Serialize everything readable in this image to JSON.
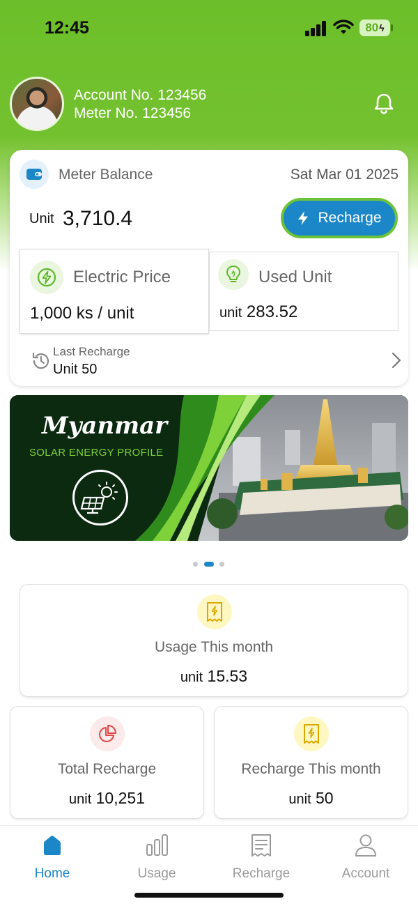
{
  "status_bar": {
    "time": "12:45",
    "battery": "80"
  },
  "header": {
    "account_label": "Account No. 123456",
    "meter_label": "Meter No. 123456"
  },
  "balance_card": {
    "title": "Meter Balance",
    "date": "Sat Mar 01 2025",
    "unit_prefix": "Unit",
    "balance": "3,710.4",
    "recharge_button": "Recharge",
    "electric_price": {
      "title": "Electric Price",
      "value": "1,000 ks / unit"
    },
    "used_unit": {
      "title": "Used Unit",
      "unit_prefix": "unit",
      "value": "283.52"
    },
    "last_recharge": {
      "label": "Last Recharge",
      "value": "Unit 50"
    }
  },
  "banner": {
    "title": "Myanmar",
    "subtitle": "SOLAR ENERGY PROFILE",
    "slides": 3,
    "active_slide": 1
  },
  "stats": {
    "usage_this_month": {
      "title": "Usage This month",
      "unit_prefix": "unit",
      "value": "15.53"
    },
    "total_recharge": {
      "title": "Total Recharge",
      "unit_prefix": "unit",
      "value": "10,251"
    },
    "recharge_this_month": {
      "title": "Recharge This month",
      "unit_prefix": "unit",
      "value": "50"
    }
  },
  "bottom_nav": [
    {
      "label": "Home",
      "icon": "home-icon",
      "active": true
    },
    {
      "label": "Usage",
      "icon": "bar-chart-icon",
      "active": false
    },
    {
      "label": "Recharge",
      "icon": "receipt-icon",
      "active": false
    },
    {
      "label": "Account",
      "icon": "user-icon",
      "active": false
    }
  ],
  "colors": {
    "brand_green": "#74c12f",
    "accent_blue": "#1b86c8",
    "icon_yellow_bg": "#fff7c2",
    "icon_red_bg": "#fdeaea"
  }
}
